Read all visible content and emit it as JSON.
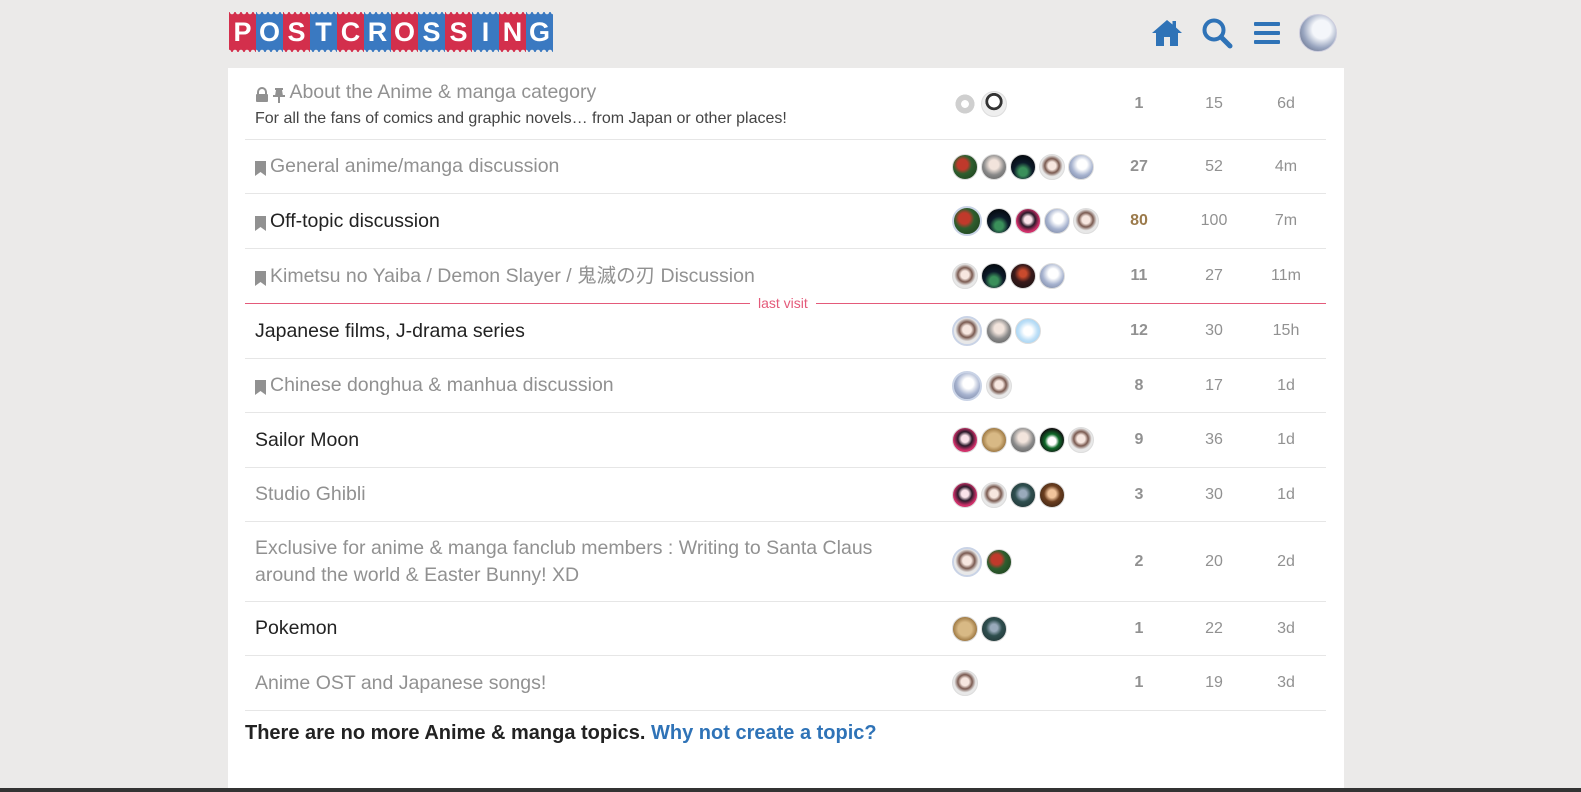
{
  "header": {
    "logo_letters": [
      "P",
      "O",
      "S",
      "T",
      "C",
      "R",
      "O",
      "S",
      "S",
      "I",
      "N",
      "G"
    ],
    "icons": [
      "home-icon",
      "search-icon",
      "hamburger-menu-icon",
      "user-avatar"
    ],
    "accent_color": "#3a79c1",
    "brand_red": "#d32f4c"
  },
  "topics": [
    {
      "title": "About the Anime & manga category",
      "excerpt": "For all the fans of comics and graphic novels… from Japan or other places!",
      "locked": true,
      "pinned": true,
      "bookmarked": false,
      "unread": false,
      "posters": [
        "gear",
        "sketch"
      ],
      "replies": "1",
      "views": "15",
      "activity": "6d",
      "hot": false
    },
    {
      "title": "General anime/manga discussion",
      "excerpt": "",
      "locked": false,
      "pinned": false,
      "bookmarked": true,
      "unread": false,
      "posters": [
        "red",
        "gray",
        "night",
        "girl",
        "white"
      ],
      "replies": "27",
      "views": "52",
      "activity": "4m",
      "hot": false
    },
    {
      "title": "Off-topic discussion",
      "excerpt": "",
      "locked": false,
      "pinned": false,
      "bookmarked": true,
      "unread": true,
      "posters": [
        "red",
        "night",
        "pink",
        "white",
        "girl"
      ],
      "replies": "80",
      "views": "100",
      "activity": "7m",
      "hot": true
    },
    {
      "title": "Kimetsu no Yaiba / Demon Slayer / 鬼滅の刃 Discussion",
      "excerpt": "",
      "locked": false,
      "pinned": false,
      "bookmarked": true,
      "unread": false,
      "posters": [
        "girl",
        "night",
        "dark",
        "white"
      ],
      "replies": "11",
      "views": "27",
      "activity": "11m",
      "hot": false
    },
    {
      "title": "Japanese films, J-drama series",
      "excerpt": "",
      "locked": false,
      "pinned": false,
      "bookmarked": false,
      "unread": true,
      "posters": [
        "girl",
        "gray",
        "light"
      ],
      "replies": "12",
      "views": "30",
      "activity": "15h",
      "hot": false
    },
    {
      "title": "Chinese donghua & manhua discussion",
      "excerpt": "",
      "locked": false,
      "pinned": false,
      "bookmarked": true,
      "unread": false,
      "posters": [
        "white",
        "girl"
      ],
      "replies": "8",
      "views": "17",
      "activity": "1d",
      "hot": false
    },
    {
      "title": "Sailor Moon",
      "excerpt": "",
      "locked": false,
      "pinned": false,
      "bookmarked": false,
      "unread": true,
      "posters": [
        "pink",
        "tan",
        "gray",
        "hat",
        "girl"
      ],
      "replies": "9",
      "views": "36",
      "activity": "1d",
      "hot": false
    },
    {
      "title": "Studio Ghibli",
      "excerpt": "",
      "locked": false,
      "pinned": false,
      "bookmarked": false,
      "unread": false,
      "posters": [
        "pink",
        "girl",
        "teal",
        "brown"
      ],
      "replies": "3",
      "views": "30",
      "activity": "1d",
      "hot": false
    },
    {
      "title": "Exclusive for anime & manga fanclub members : Writing to Santa Claus around the world & Easter Bunny! XD",
      "excerpt": "",
      "locked": false,
      "pinned": false,
      "bookmarked": false,
      "unread": false,
      "posters": [
        "girl",
        "red"
      ],
      "replies": "2",
      "views": "20",
      "activity": "2d",
      "hot": false
    },
    {
      "title": "Pokemon",
      "excerpt": "",
      "locked": false,
      "pinned": false,
      "bookmarked": false,
      "unread": true,
      "posters": [
        "tan",
        "teal"
      ],
      "replies": "1",
      "views": "22",
      "activity": "3d",
      "hot": false
    },
    {
      "title": "Anime OST and Japanese songs!",
      "excerpt": "",
      "locked": false,
      "pinned": false,
      "bookmarked": false,
      "unread": false,
      "posters": [
        "girl"
      ],
      "replies": "1",
      "views": "19",
      "activity": "3d",
      "hot": false
    }
  ],
  "last_visit_label": "last visit",
  "footer": {
    "message": "There are no more Anime & manga topics.",
    "link": "Why not create a topic?"
  }
}
